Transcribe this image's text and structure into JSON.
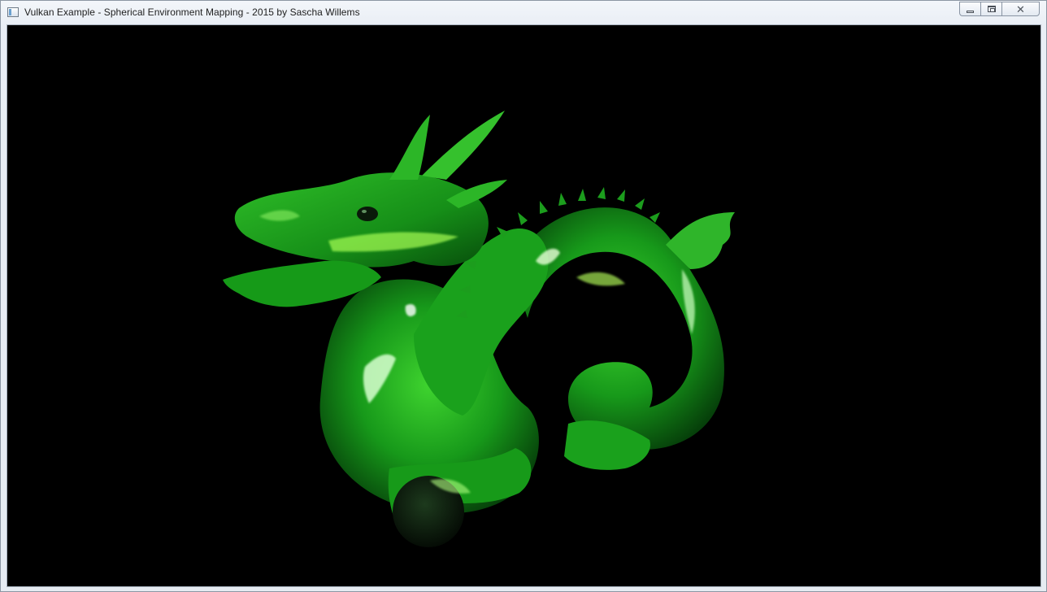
{
  "window": {
    "title": "Vulkan Example - Spherical Environment Mapping - 2015 by Sascha Willems",
    "icon": "application-window-icon",
    "buttons": {
      "minimize_icon": "minimize-icon",
      "maximize_icon": "restore-icon",
      "close_glyph": "✕"
    }
  },
  "viewport": {
    "background_color": "#000000",
    "model": "dragon",
    "material_color": "#1fae1a",
    "highlight_color": "#b8ff6a"
  }
}
